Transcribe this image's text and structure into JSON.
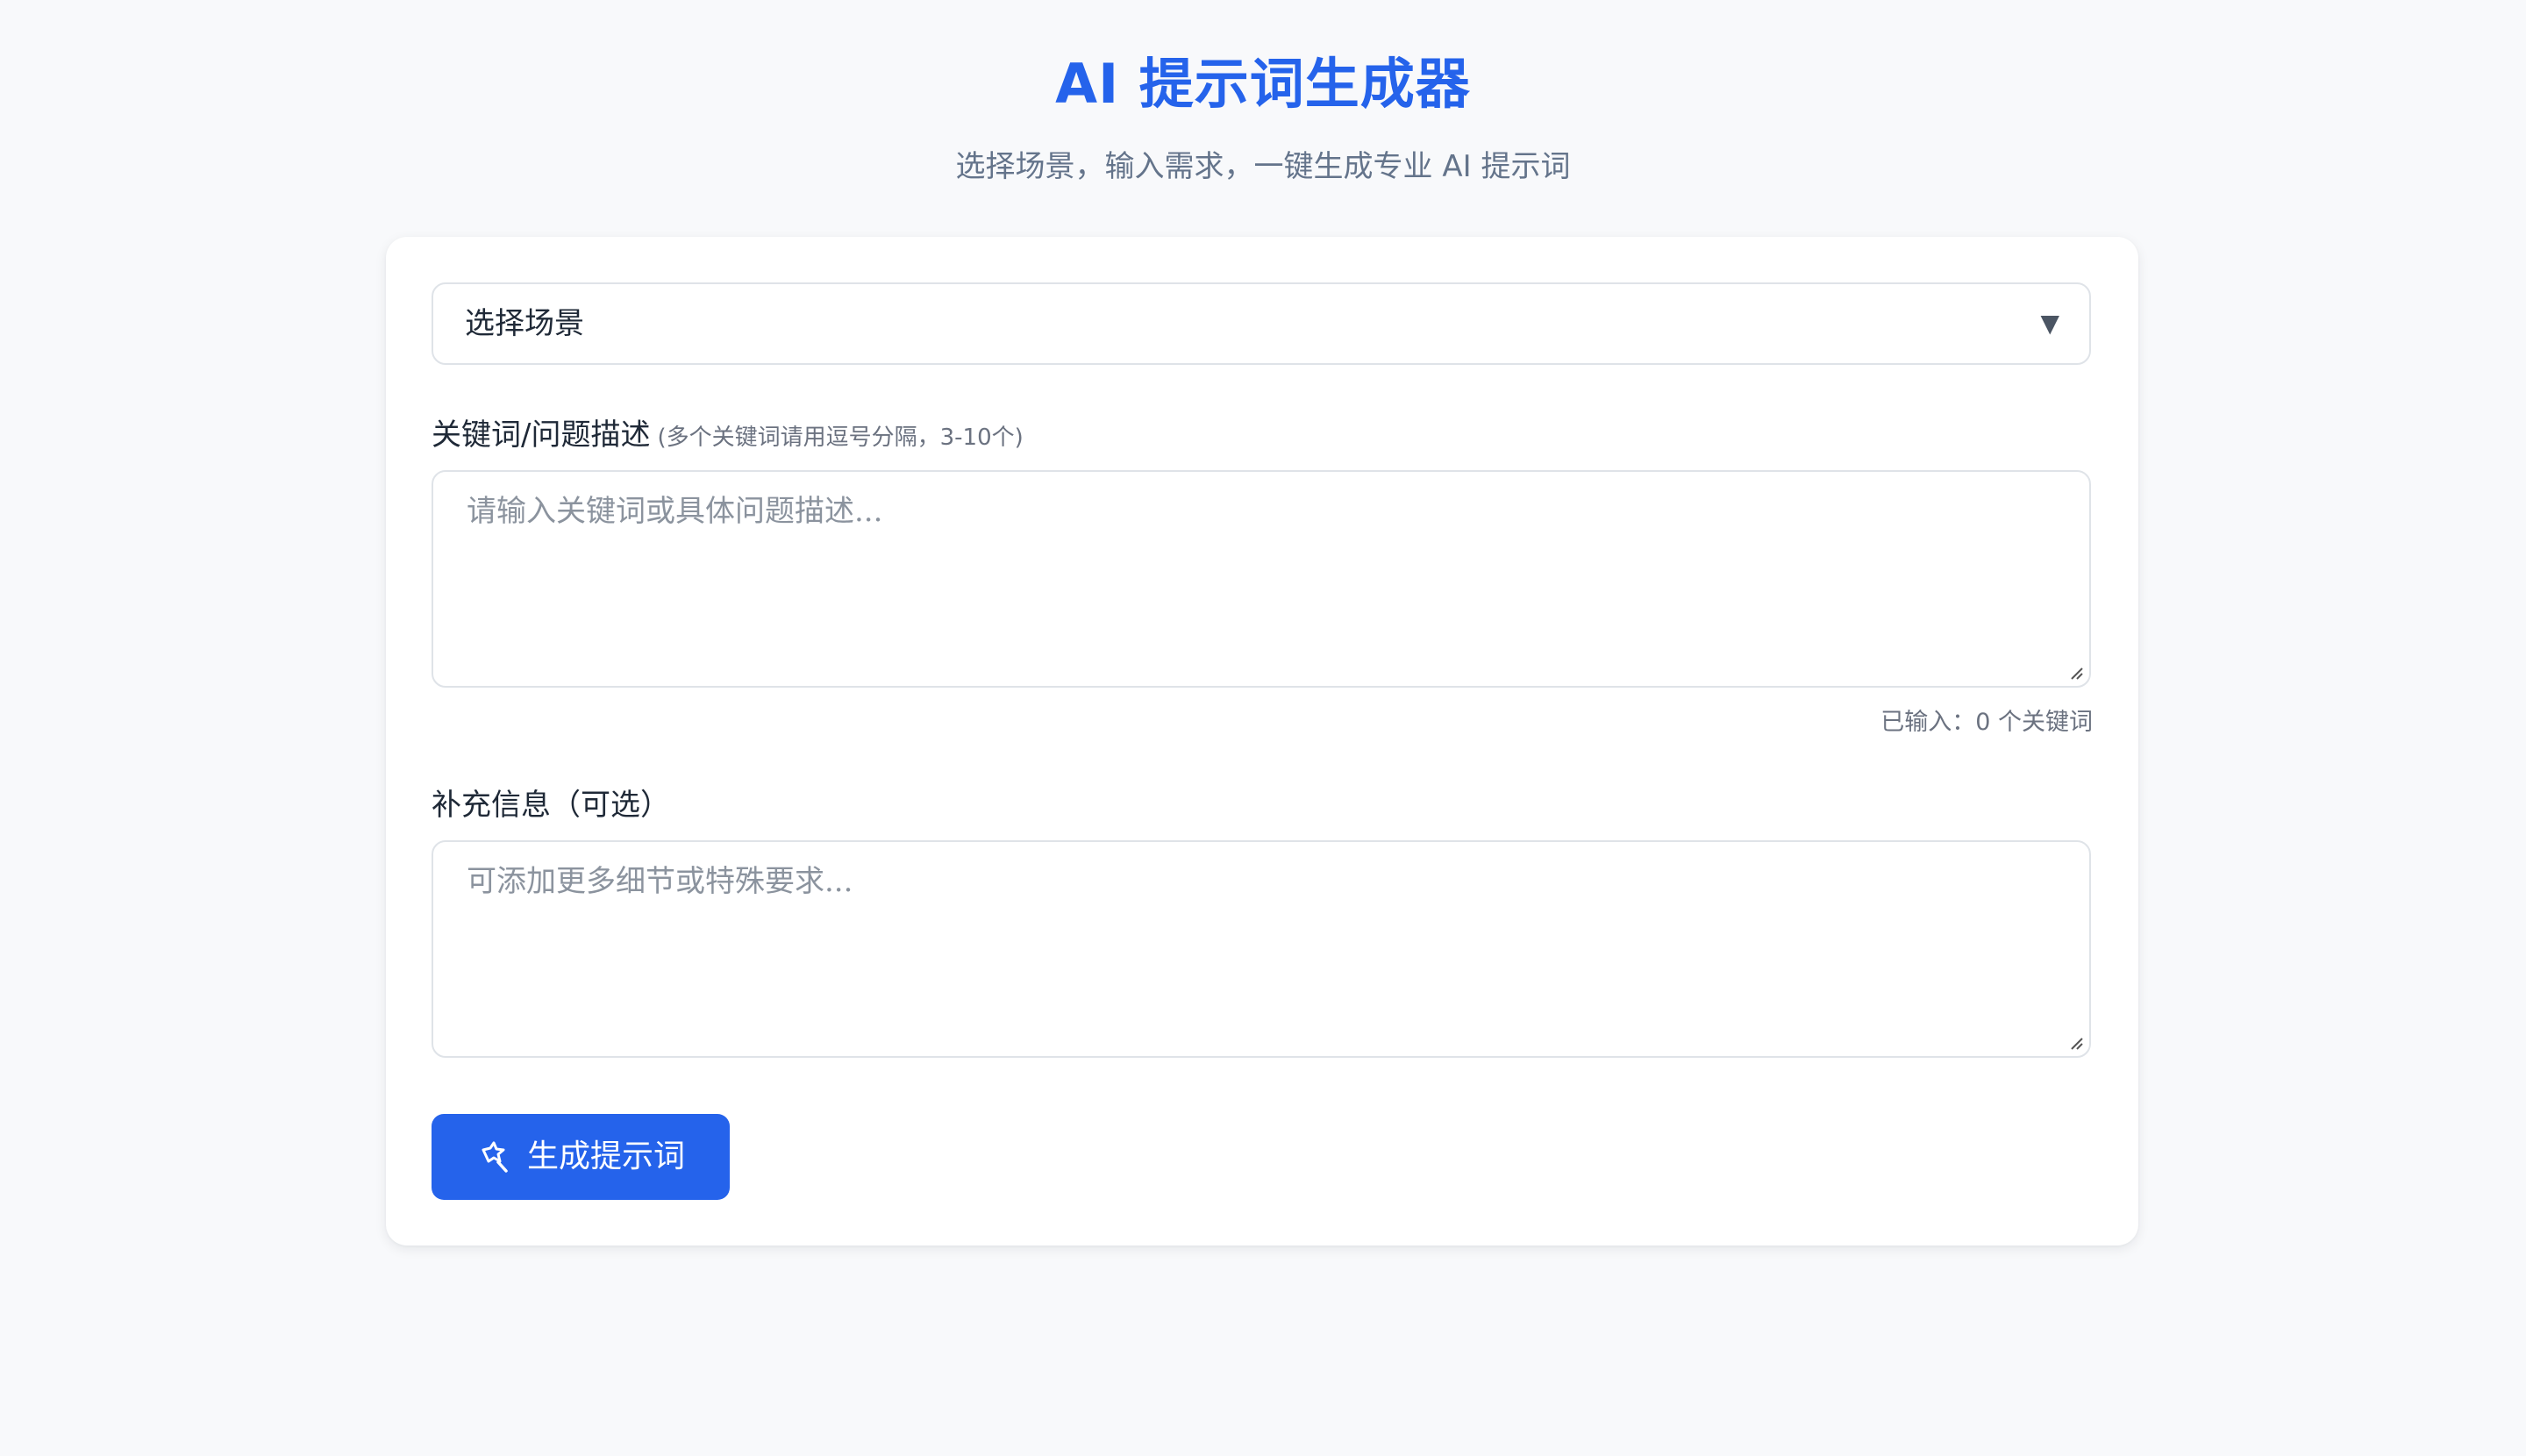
{
  "header": {
    "title": "AI 提示词生成器",
    "subtitle": "选择场景，输入需求，一键生成专业 AI 提示词"
  },
  "form": {
    "scene_select": {
      "value": "选择场景",
      "arrow_icon": "triangle-down-icon"
    },
    "keywords": {
      "label": "关键词/问题描述",
      "hint": "(多个关键词请用逗号分隔，3-10个)",
      "placeholder": "请输入关键词或具体问题描述...",
      "value": "",
      "counter": "已输入：0 个关键词"
    },
    "extra": {
      "label": "补充信息（可选）",
      "placeholder": "可添加更多细节或特殊要求...",
      "value": ""
    },
    "generate_button": {
      "label": "生成提示词",
      "icon": "magic-wand-icon"
    }
  },
  "colors": {
    "accent": "#2563eb",
    "background": "#f8f9fb",
    "card": "#ffffff",
    "border": "#dfe3e8",
    "muted_text": "#64748b"
  }
}
